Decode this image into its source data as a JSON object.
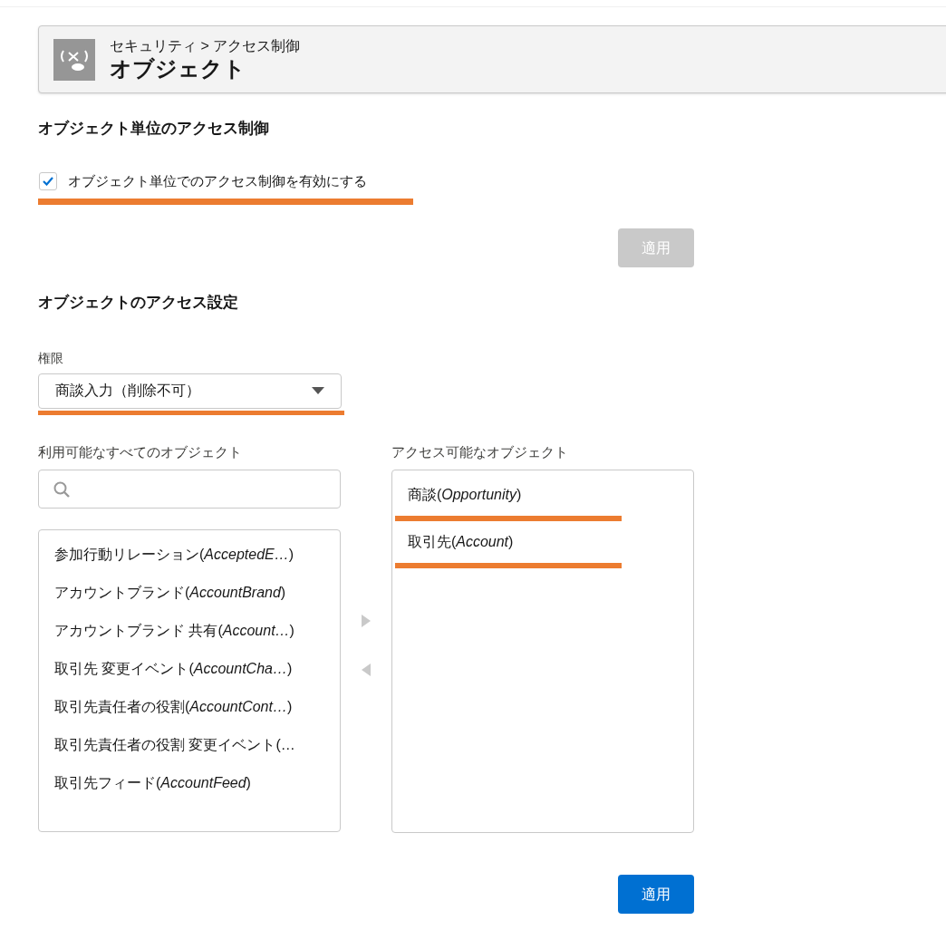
{
  "header": {
    "breadcrumb": "セキュリティ > アクセス制御",
    "title": "オブジェクト"
  },
  "object_access_control": {
    "heading": "オブジェクト単位のアクセス制御",
    "checkbox": {
      "label": "オブジェクト単位でのアクセス制御を有効にする",
      "checked": true,
      "highlighted": true
    },
    "apply_button": {
      "label": "適用",
      "disabled": true
    }
  },
  "object_access_settings": {
    "heading": "オブジェクトのアクセス設定",
    "permission": {
      "label": "権限",
      "value": "商談入力（削除不可）",
      "highlighted": true
    },
    "available": {
      "label": "利用可能なすべてのオブジェクト",
      "items": [
        {
          "text": "参加行動リレーション(*AcceptedE…*)",
          "highlighted": false
        },
        {
          "text": "アカウントブランド(*AccountBrand*)",
          "highlighted": false
        },
        {
          "text": "アカウントブランド 共有(*Account…*)",
          "highlighted": false
        },
        {
          "text": "取引先 変更イベント(*AccountCha…*)",
          "highlighted": false
        },
        {
          "text": "取引先責任者の役割(*AccountCont…*)",
          "highlighted": false
        },
        {
          "text": "取引先責任者の役割 変更イベント(…",
          "highlighted": false
        },
        {
          "text": "取引先フィード(*AccountFeed*)",
          "highlighted": false
        }
      ]
    },
    "accessible": {
      "label": "アクセス可能なオブジェクト",
      "items": [
        {
          "text": "商談(*Opportunity*)",
          "highlighted": true
        },
        {
          "text": "取引先(*Account*)",
          "highlighted": true
        }
      ]
    },
    "apply_button": {
      "label": "適用",
      "disabled": false
    }
  }
}
